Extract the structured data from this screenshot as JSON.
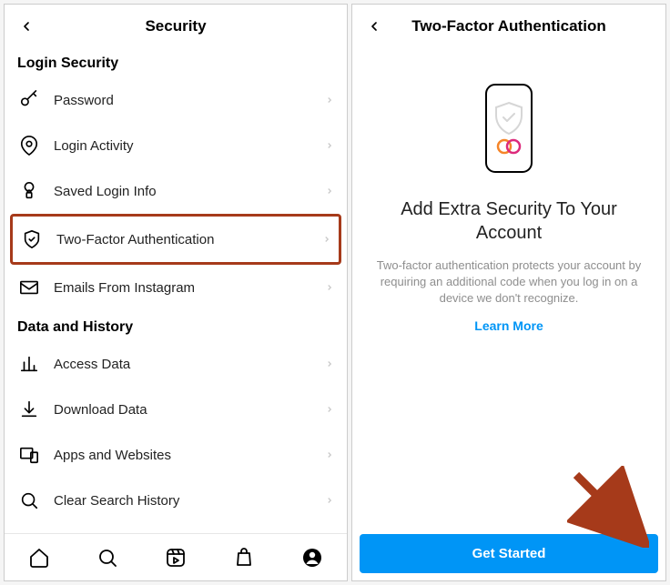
{
  "left": {
    "title": "Security",
    "section1": "Login Security",
    "items1": [
      {
        "label": "Password"
      },
      {
        "label": "Login Activity"
      },
      {
        "label": "Saved Login Info"
      },
      {
        "label": "Two-Factor Authentication"
      },
      {
        "label": "Emails From Instagram"
      }
    ],
    "section2": "Data and History",
    "items2": [
      {
        "label": "Access Data"
      },
      {
        "label": "Download Data"
      },
      {
        "label": "Apps and Websites"
      },
      {
        "label": "Clear Search History"
      }
    ]
  },
  "right": {
    "title": "Two-Factor Authentication",
    "heading": "Add Extra Security To Your Account",
    "body": "Two-factor authentication protects your account by requiring an additional code when you log in on a device we don't recognize.",
    "learn_more": "Learn More",
    "cta": "Get Started"
  },
  "highlight_color": "#a63a1a"
}
